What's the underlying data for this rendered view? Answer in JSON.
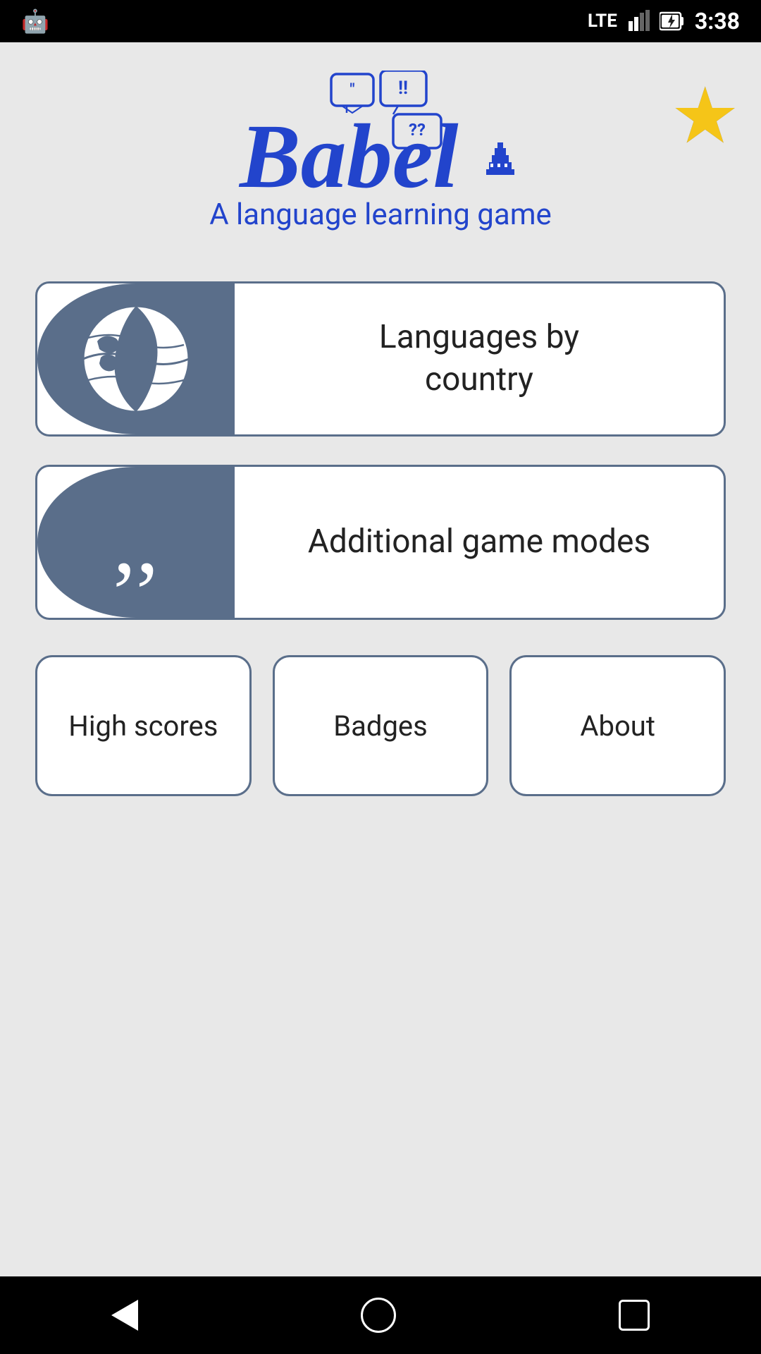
{
  "statusBar": {
    "lte": "LTE",
    "time": "3:38"
  },
  "header": {
    "logoTitle": "Babel",
    "subtitle": "A language learning game",
    "starLabel": "favorites"
  },
  "buttons": {
    "languagesByCountry": "Languages by\ncountry",
    "additionalGameModes": "Additional game modes"
  },
  "bottomButtons": {
    "highScores": "High scores",
    "badges": "Badges",
    "about": "About"
  },
  "navigation": {
    "back": "back",
    "home": "home",
    "recent": "recent"
  }
}
